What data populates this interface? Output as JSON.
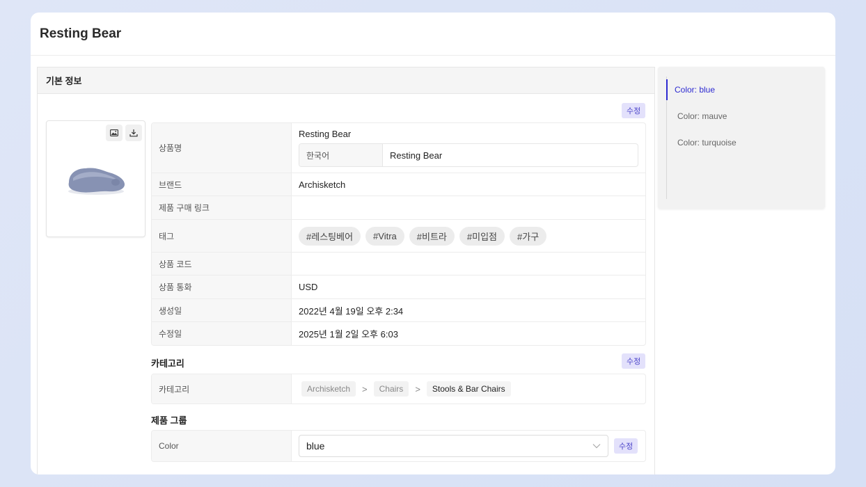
{
  "page": {
    "title": "Resting Bear"
  },
  "basic_info": {
    "section_title": "기본 정보",
    "edit_label": "수정",
    "rows": {
      "name": {
        "label": "상품명",
        "value": "Resting Bear",
        "lang_key": "한국어",
        "lang_value": "Resting Bear"
      },
      "brand": {
        "label": "브랜드",
        "value": "Archisketch"
      },
      "purchase_link": {
        "label": "제품 구매 링크",
        "value": ""
      },
      "tags": {
        "label": "태그",
        "items": [
          "#레스팅베어",
          "#Vitra",
          "#비트라",
          "#미입점",
          "#가구"
        ]
      },
      "code": {
        "label": "상품 코드",
        "value": ""
      },
      "currency": {
        "label": "상품 통화",
        "value": "USD"
      },
      "created": {
        "label": "생성일",
        "value": "2022년 4월 19일 오후 2:34"
      },
      "modified": {
        "label": "수정일",
        "value": "2025년 1월 2일 오후 6:03"
      }
    }
  },
  "category": {
    "section_title": "카테고리",
    "edit_label": "수정",
    "row_label": "카테고리",
    "path": [
      "Archisketch",
      "Chairs",
      "Stools & Bar Chairs"
    ],
    "separator": ">"
  },
  "product_group": {
    "section_title": "제품 그룹",
    "row_label": "Color",
    "selected": "blue",
    "edit_label": "수정"
  },
  "side_nav": {
    "items": [
      "Color: blue",
      "Color: mauve",
      "Color: turquoise"
    ],
    "active_index": 0,
    "accent": "#2d2ad1"
  },
  "icons": {
    "image_tool": "image-icon",
    "download_tool": "download-icon",
    "select_arrow": "chevron-down-icon"
  }
}
